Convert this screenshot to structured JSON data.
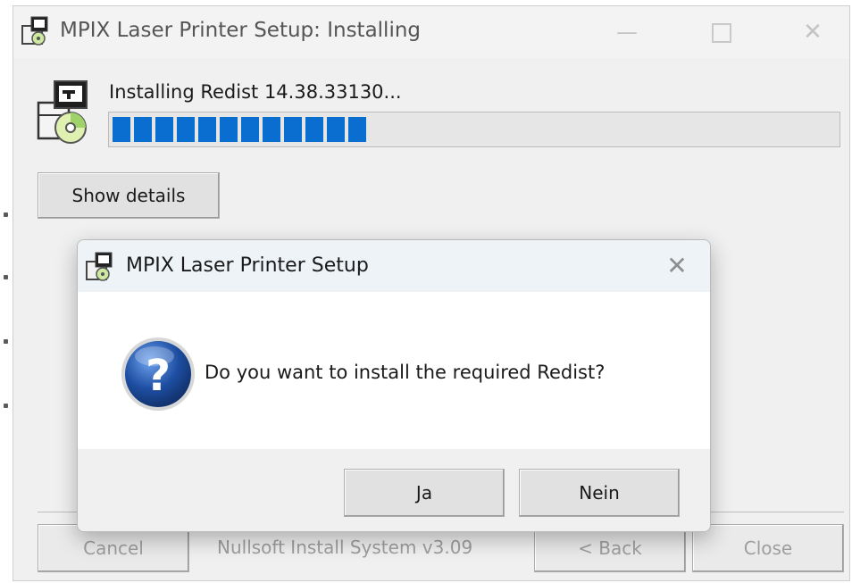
{
  "main_window": {
    "title": "MPIX Laser Printer Setup: Installing",
    "controls": {
      "minimize": "—",
      "close": "✕"
    },
    "status_text": "Installing Redist 14.38.33130...",
    "progress": {
      "fraction": 0.36
    },
    "show_details_label": "Show details",
    "footer": {
      "cancel_label": "Cancel",
      "branding": "Nullsoft Install System v3.09",
      "back_label": "< Back",
      "close_label": "Close"
    }
  },
  "dialog": {
    "title": "MPIX Laser Printer Setup",
    "close_glyph": "✕",
    "message": "Do you want to install the required Redist?",
    "yes_label": "Ja",
    "no_label": "Nein"
  },
  "icons": {
    "app": "installer-box-icon",
    "installer": "installer-cd-icon",
    "question": "question-icon"
  },
  "colors": {
    "progress": "#0a6ed1",
    "question_blue": "#1e4fa3"
  }
}
